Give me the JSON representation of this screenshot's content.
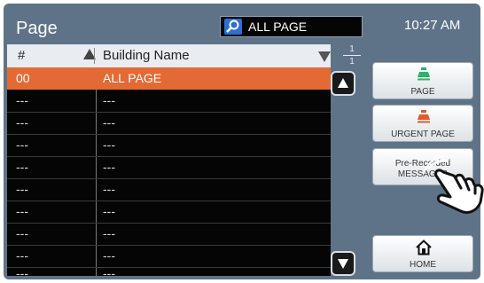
{
  "header": {
    "title": "Page",
    "search_value": "ALL PAGE",
    "time": "10:27 AM"
  },
  "table": {
    "columns": [
      "#",
      "Building Name"
    ],
    "rows": [
      {
        "num": "00",
        "name": "ALL PAGE",
        "selected": true
      },
      {
        "num": "---",
        "name": "---"
      },
      {
        "num": "---",
        "name": "---"
      },
      {
        "num": "---",
        "name": "---"
      },
      {
        "num": "---",
        "name": "---"
      },
      {
        "num": "---",
        "name": "---"
      },
      {
        "num": "---",
        "name": "---"
      },
      {
        "num": "---",
        "name": "---"
      },
      {
        "num": "---",
        "name": "---"
      },
      {
        "num": "---",
        "name": "---"
      }
    ]
  },
  "pager": {
    "current": "1",
    "total": "1"
  },
  "buttons": {
    "page": "PAGE",
    "urgent_page": "URGENT PAGE",
    "prerecorded_line1": "Pre-Recorded",
    "prerecorded_line2": "MESSAGES",
    "home": "HOME"
  },
  "colors": {
    "background": "#5e7387",
    "selected_row": "#e46a35",
    "page_icon": "#2bb36a",
    "urgent_icon": "#e05a2a",
    "search_icon": "#2f6fd3"
  },
  "icons": [
    "search-icon",
    "sort-ascending-icon",
    "sort-descending-icon",
    "scroll-up-icon",
    "scroll-down-icon",
    "page-speaker-icon",
    "urgent-speaker-icon",
    "home-icon",
    "touch-hand-icon"
  ]
}
